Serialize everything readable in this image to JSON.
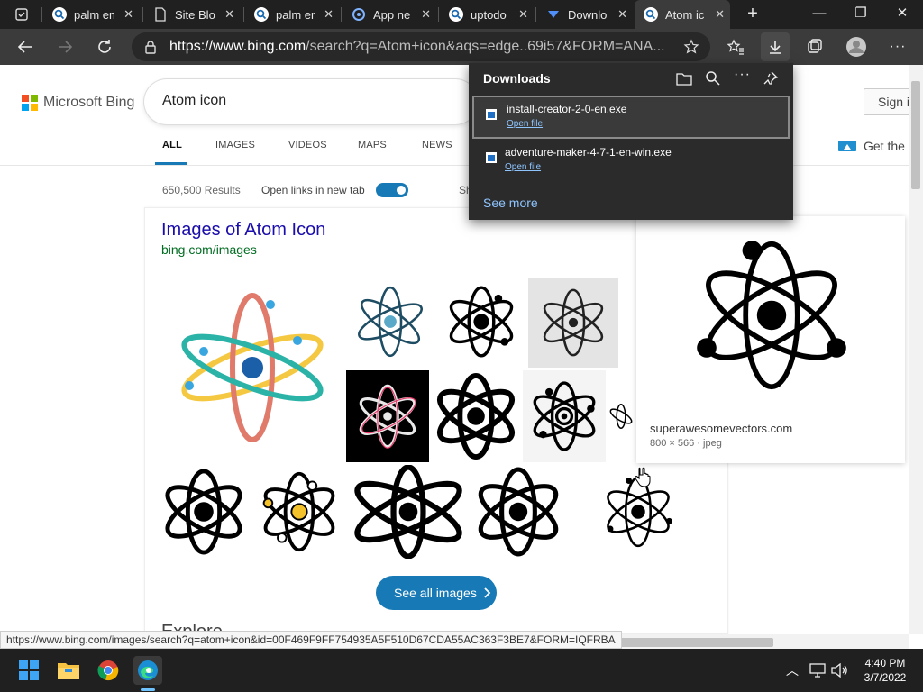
{
  "tabs": [
    {
      "title": "palm em",
      "icon": "search-icon"
    },
    {
      "title": "Site Blo",
      "icon": "document-icon"
    },
    {
      "title": "palm em",
      "icon": "search-icon"
    },
    {
      "title": "App ne",
      "icon": "app-icon"
    },
    {
      "title": "uptodo",
      "icon": "search-icon"
    },
    {
      "title": "Downlo",
      "icon": "download-site-icon"
    },
    {
      "title": "Atom ic",
      "icon": "search-icon"
    }
  ],
  "address": {
    "host": "https://www.bing.com",
    "rest": "/search?q=Atom+icon&aqs=edge..69i57&FORM=ANA..."
  },
  "bing": {
    "logo_text": "Microsoft Bing",
    "query": "Atom icon",
    "signin": "Sign i"
  },
  "nav": {
    "all": "ALL",
    "images": "IMAGES",
    "videos": "VIDEOS",
    "maps": "MAPS",
    "news": "NEWS",
    "getthe": "Get the"
  },
  "results": {
    "count": "650,500 Results",
    "open_links": "Open links in new tab",
    "sh": "Sh"
  },
  "images_card": {
    "title": "Images of Atom Icon",
    "url": "bing.com/images",
    "see_all": "See all images",
    "explore": "Explore"
  },
  "preview": {
    "source": "superawesomevectors.com",
    "meta": "800 × 566 · jpeg"
  },
  "downloads": {
    "title": "Downloads",
    "items": [
      {
        "name": "install-creator-2-0-en.exe",
        "action": "Open file"
      },
      {
        "name": "adventure-maker-4-7-1-en-win.exe",
        "action": "Open file"
      }
    ],
    "see_more": "See more"
  },
  "status_url": "https://www.bing.com/images/search?q=atom+icon&id=00F469F9FF754935A5F510D67CDA55AC363F3BE7&FORM=IQFRBA",
  "clock": {
    "time": "4:40 PM",
    "date": "3/7/2022"
  },
  "colors": {
    "accent": "#177ab6",
    "link": "#1a0dab"
  }
}
